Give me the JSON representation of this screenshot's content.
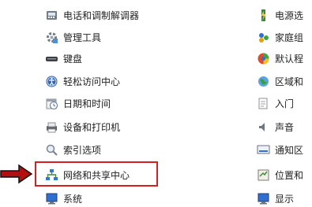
{
  "left_items": [
    {
      "label": "电话和调制解调器",
      "icon": "phone-modem-icon"
    },
    {
      "label": "管理工具",
      "icon": "admin-tools-icon"
    },
    {
      "label": "键盘",
      "icon": "keyboard-icon"
    },
    {
      "label": "轻松访问中心",
      "icon": "ease-of-access-icon"
    },
    {
      "label": "日期和时间",
      "icon": "date-time-icon"
    },
    {
      "label": "设备和打印机",
      "icon": "devices-printers-icon"
    },
    {
      "label": "索引选项",
      "icon": "indexing-options-icon"
    },
    {
      "label": "网络和共享中心",
      "icon": "network-sharing-icon"
    },
    {
      "label": "系统",
      "icon": "system-icon"
    }
  ],
  "right_items": [
    {
      "label": "电源选",
      "icon": "power-options-icon"
    },
    {
      "label": "家庭组",
      "icon": "homegroup-icon"
    },
    {
      "label": "默认程",
      "icon": "default-programs-icon"
    },
    {
      "label": "区域和",
      "icon": "region-icon"
    },
    {
      "label": "入门",
      "icon": "getting-started-icon"
    },
    {
      "label": "声音",
      "icon": "sound-icon"
    },
    {
      "label": "通知区",
      "icon": "notification-area-icon"
    },
    {
      "label": "位置和",
      "icon": "location-icon"
    },
    {
      "label": "显示",
      "icon": "display-icon"
    }
  ],
  "highlight_color": "#d61f1f",
  "arrow_color": "#b01010"
}
